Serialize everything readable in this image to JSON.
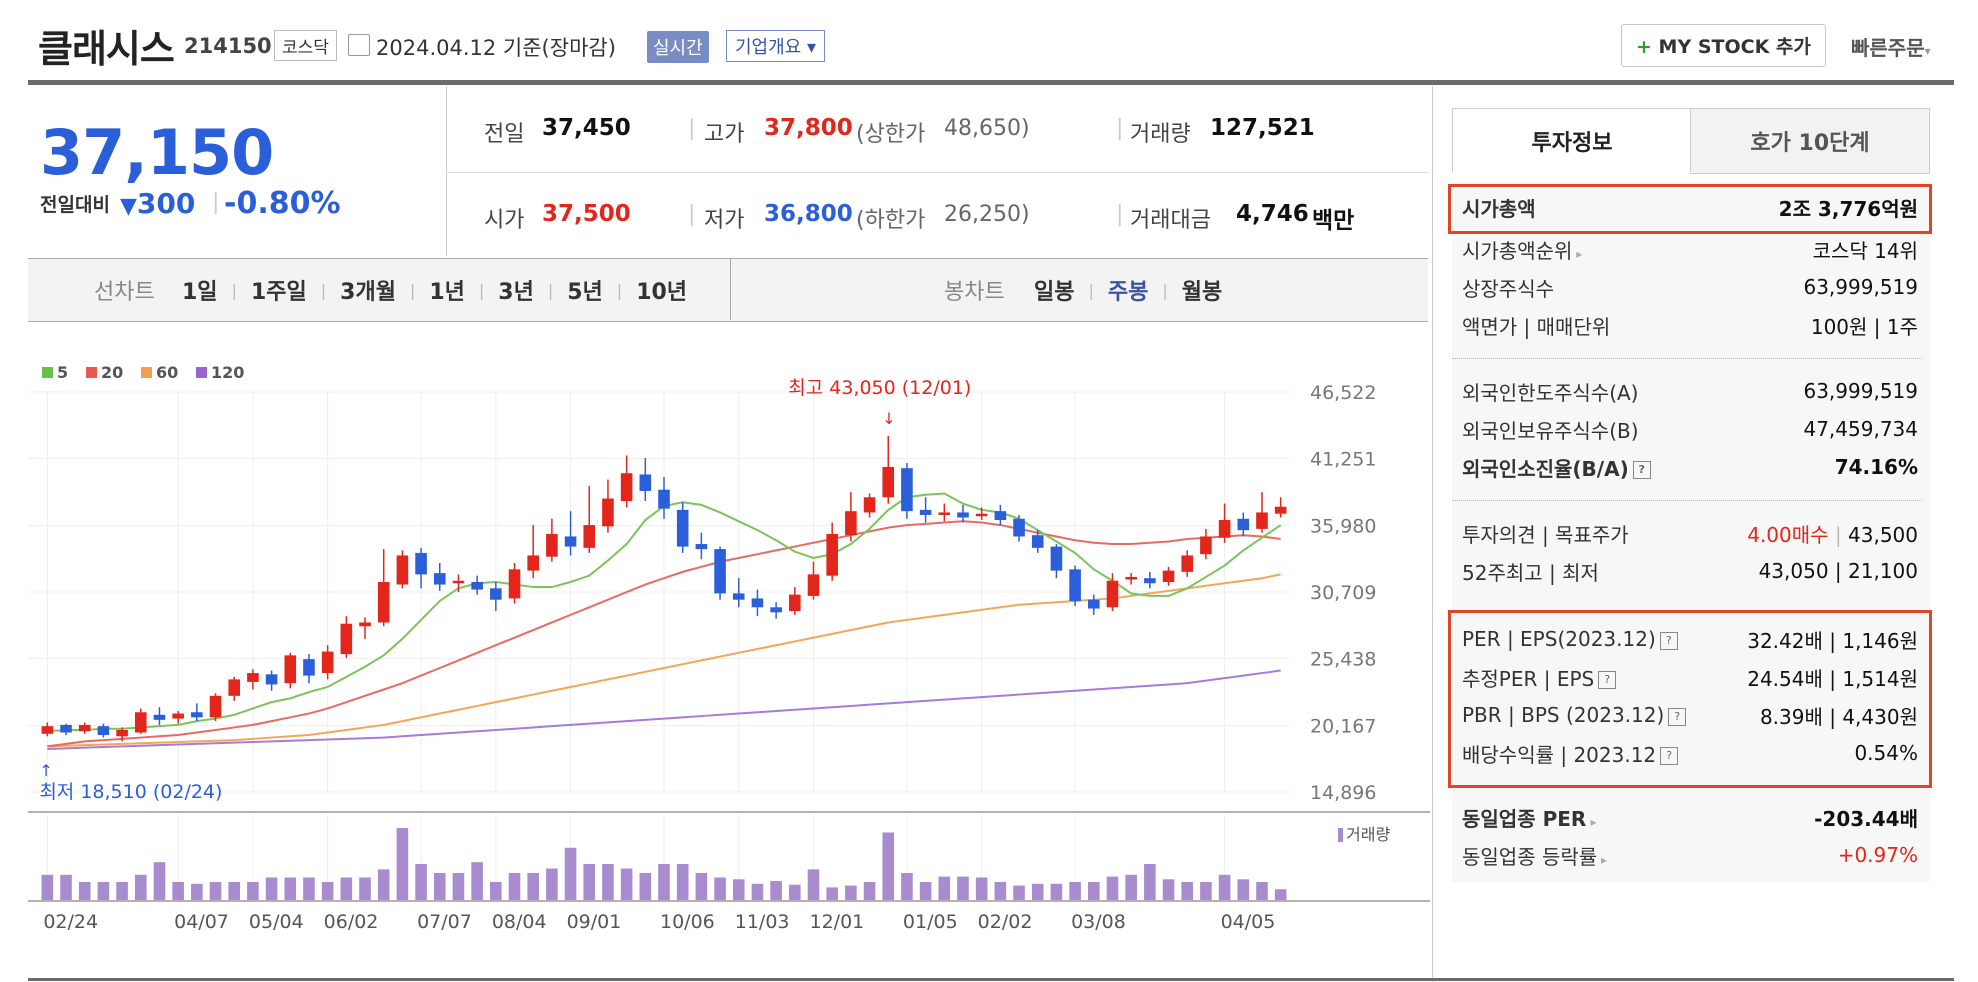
{
  "header": {
    "company_name": "클래시스",
    "code": "214150",
    "market": "코스닥",
    "date_label": "2024.04.12 기준(장마감)",
    "realtime_label": "실시간",
    "company_info_label": "기업개요",
    "my_stock_label": "MY STOCK 추가",
    "quick_order_label": "빠른주문"
  },
  "quote": {
    "price": "37,150",
    "change_label": "전일대비",
    "change_value": "300",
    "change_pct": "-0.80%",
    "prev_close_label": "전일",
    "prev_close": "37,450",
    "high_label": "고가",
    "high": "37,800",
    "upper_limit_label": "(상한가",
    "upper_limit": "48,650)",
    "volume_label": "거래량",
    "volume": "127,521",
    "open_label": "시가",
    "open": "37,500",
    "low_label": "저가",
    "low": "36,800",
    "lower_limit_label": "(하한가",
    "lower_limit": "26,250)",
    "amount_label": "거래대금",
    "amount": "4,746",
    "amount_unit": "백만"
  },
  "periods": {
    "line_label": "선차트",
    "line_items": [
      "1일",
      "1주일",
      "3개월",
      "1년",
      "3년",
      "5년",
      "10년"
    ],
    "candle_label": "봉차트",
    "candle_items": [
      "일봉",
      "주봉",
      "월봉"
    ],
    "active_candle": "주봉"
  },
  "chart_data": {
    "type": "candlestick",
    "legend": [
      {
        "name": "5",
        "color": "#6cc04a"
      },
      {
        "name": "20",
        "color": "#e85a4f"
      },
      {
        "name": "60",
        "color": "#f0a050"
      },
      {
        "name": "120",
        "color": "#9966cc"
      }
    ],
    "y_ticks": [
      "46,522",
      "41,251",
      "35,980",
      "30,709",
      "25,438",
      "20,167",
      "14,896"
    ],
    "ylim": [
      14896,
      46522
    ],
    "x_ticks": [
      "02/24",
      "04/07",
      "05/04",
      "06/02",
      "07/07",
      "08/04",
      "09/01",
      "10/06",
      "11/03",
      "12/01",
      "01/05",
      "02/02",
      "03/08",
      "04/05"
    ],
    "high_annotation": "최고 43,050 (12/01)",
    "low_annotation": "최저 18,510 (02/24)",
    "volume_label": "거래량",
    "candles": [
      [
        19500,
        20100,
        19300,
        20400
      ],
      [
        20200,
        19600,
        19400,
        20300
      ],
      [
        19700,
        20200,
        19500,
        20400
      ],
      [
        20100,
        19400,
        19200,
        20300
      ],
      [
        19300,
        19800,
        18900,
        20000
      ],
      [
        19600,
        21200,
        19500,
        21500
      ],
      [
        21000,
        20600,
        20200,
        21600
      ],
      [
        20700,
        21100,
        20300,
        21300
      ],
      [
        21200,
        20800,
        20500,
        21900
      ],
      [
        20800,
        22500,
        20500,
        22700
      ],
      [
        22500,
        23800,
        22100,
        24000
      ],
      [
        23600,
        24300,
        23000,
        24600
      ],
      [
        24200,
        23400,
        22900,
        24500
      ],
      [
        23500,
        25700,
        23100,
        25900
      ],
      [
        25400,
        24100,
        23500,
        25800
      ],
      [
        24300,
        26000,
        23800,
        26500
      ],
      [
        25800,
        28200,
        25500,
        28800
      ],
      [
        28000,
        28300,
        27000,
        28700
      ],
      [
        28300,
        31500,
        28000,
        34100
      ],
      [
        31300,
        33600,
        31000,
        34000
      ],
      [
        33800,
        32100,
        31000,
        34200
      ],
      [
        32200,
        31300,
        30800,
        33000
      ],
      [
        31400,
        31600,
        30700,
        32100
      ],
      [
        31500,
        30900,
        30500,
        32000
      ],
      [
        31000,
        30100,
        29200,
        31500
      ],
      [
        30200,
        32500,
        29800,
        33000
      ],
      [
        32400,
        33600,
        31800,
        36000
      ],
      [
        33500,
        35300,
        33100,
        36500
      ],
      [
        35100,
        34300,
        33600,
        37100
      ],
      [
        34200,
        36000,
        33800,
        39100
      ],
      [
        35900,
        38100,
        35400,
        39600
      ],
      [
        37900,
        40100,
        37400,
        41500
      ],
      [
        40000,
        38700,
        37900,
        41300
      ],
      [
        38800,
        37300,
        36500,
        39800
      ],
      [
        37200,
        34300,
        33800,
        37800
      ],
      [
        34500,
        34100,
        33300,
        35400
      ],
      [
        34100,
        30600,
        30100,
        34300
      ],
      [
        30600,
        30100,
        29500,
        31800
      ],
      [
        30200,
        29500,
        28800,
        30900
      ],
      [
        29500,
        29100,
        28600,
        29900
      ],
      [
        29200,
        30500,
        28900,
        31100
      ],
      [
        30400,
        32100,
        30100,
        33100
      ],
      [
        32000,
        35300,
        31600,
        36200
      ],
      [
        35200,
        37100,
        34700,
        38600
      ],
      [
        37000,
        38200,
        36600,
        38500
      ],
      [
        38200,
        40600,
        37700,
        43050
      ],
      [
        40500,
        37100,
        36500,
        40900
      ],
      [
        37200,
        36800,
        36200,
        38200
      ],
      [
        36800,
        37000,
        36300,
        37700
      ],
      [
        37000,
        36600,
        36200,
        37600
      ],
      [
        36700,
        36900,
        36400,
        37400
      ],
      [
        37100,
        36400,
        36000,
        37600
      ],
      [
        36500,
        35100,
        34700,
        36800
      ],
      [
        35200,
        34200,
        33800,
        35600
      ],
      [
        34300,
        32400,
        31800,
        34500
      ],
      [
        32500,
        30000,
        29600,
        32800
      ],
      [
        30100,
        29400,
        28900,
        30500
      ],
      [
        29500,
        31600,
        29200,
        32200
      ],
      [
        31700,
        31900,
        31300,
        32200
      ],
      [
        31800,
        31400,
        31000,
        32300
      ],
      [
        31500,
        32400,
        31200,
        32700
      ],
      [
        32300,
        33600,
        31900,
        34000
      ],
      [
        33700,
        35100,
        33300,
        35700
      ],
      [
        35000,
        36400,
        34600,
        37700
      ],
      [
        36500,
        35600,
        35100,
        37000
      ],
      [
        35700,
        37000,
        35400,
        38600
      ],
      [
        36900,
        37450,
        36600,
        38200
      ]
    ],
    "volumes": [
      28,
      28,
      20,
      20,
      20,
      28,
      42,
      20,
      18,
      20,
      20,
      20,
      25,
      25,
      25,
      20,
      25,
      25,
      34,
      80,
      40,
      30,
      30,
      42,
      20,
      30,
      30,
      35,
      58,
      40,
      40,
      35,
      30,
      40,
      40,
      30,
      25,
      23,
      18,
      21,
      17,
      34,
      14,
      16,
      20,
      75,
      30,
      20,
      26,
      26,
      25,
      20,
      16,
      18,
      18,
      20,
      20,
      26,
      28,
      40,
      23,
      20,
      20,
      28,
      23,
      20,
      12
    ],
    "ma5": [
      19700,
      19800,
      19800,
      19900,
      19900,
      20000,
      20100,
      20200,
      20500,
      20700,
      21000,
      21500,
      22000,
      22300,
      22800,
      23200,
      24000,
      24800,
      25700,
      27000,
      28500,
      30000,
      31000,
      31400,
      31500,
      31300,
      31100,
      31100,
      31500,
      32000,
      33200,
      34500,
      36400,
      37500,
      37800,
      37600,
      37000,
      36300,
      35600,
      34800,
      33900,
      33400,
      33700,
      34500,
      35700,
      37200,
      38200,
      38400,
      38500,
      37700,
      37200,
      37000,
      36500,
      35600,
      34700,
      33800,
      32500,
      31600,
      30600,
      30400,
      30400,
      31000,
      31900,
      32800,
      34000,
      35000,
      36000
    ],
    "ma20": [
      18500,
      18700,
      18900,
      19000,
      19100,
      19200,
      19300,
      19400,
      19600,
      19800,
      20000,
      20200,
      20500,
      20800,
      21100,
      21500,
      22000,
      22500,
      23000,
      23500,
      24100,
      24700,
      25300,
      25900,
      26500,
      27100,
      27700,
      28300,
      28900,
      29500,
      30100,
      30700,
      31300,
      31800,
      32300,
      32700,
      33100,
      33400,
      33700,
      34000,
      34300,
      34600,
      34900,
      35200,
      35500,
      35800,
      36000,
      36100,
      36200,
      36300,
      36200,
      36000,
      35700,
      35400,
      35100,
      34800,
      34600,
      34500,
      34500,
      34600,
      34700,
      34900,
      35000,
      35100,
      35200,
      35100,
      34900
    ],
    "ma60": [
      18500,
      18550,
      18600,
      18650,
      18700,
      18750,
      18800,
      18850,
      18900,
      18950,
      19000,
      19100,
      19200,
      19300,
      19400,
      19600,
      19800,
      20000,
      20200,
      20500,
      20800,
      21100,
      21400,
      21700,
      22000,
      22300,
      22600,
      22900,
      23200,
      23500,
      23800,
      24100,
      24400,
      24700,
      25000,
      25300,
      25600,
      25900,
      26200,
      26500,
      26800,
      27100,
      27400,
      27700,
      28000,
      28300,
      28500,
      28700,
      28900,
      29100,
      29300,
      29500,
      29700,
      29800,
      29900,
      30000,
      30100,
      30200,
      30400,
      30600,
      30800,
      31000,
      31200,
      31400,
      31600,
      31800,
      32100
    ],
    "ma120": [
      18300,
      18350,
      18400,
      18450,
      18500,
      18550,
      18600,
      18650,
      18700,
      18750,
      18800,
      18850,
      18900,
      18950,
      19000,
      19050,
      19100,
      19150,
      19200,
      19300,
      19400,
      19500,
      19600,
      19700,
      19800,
      19900,
      20000,
      20100,
      20200,
      20300,
      20400,
      20500,
      20600,
      20700,
      20800,
      20900,
      21000,
      21100,
      21200,
      21300,
      21400,
      21500,
      21600,
      21700,
      21800,
      21900,
      22000,
      22100,
      22200,
      22300,
      22400,
      22500,
      22600,
      22700,
      22800,
      22900,
      23000,
      23100,
      23200,
      23300,
      23400,
      23500,
      23700,
      23900,
      24100,
      24300,
      24500
    ]
  },
  "side": {
    "tab_invest": "투자정보",
    "tab_orderbook": "호가 10단계",
    "market_cap_label": "시가총액",
    "market_cap_value": "2조 3,776억원",
    "rows1": [
      {
        "label": "시가총액순위",
        "value": "코스닥 14위"
      },
      {
        "label": "상장주식수",
        "value": "63,999,519"
      },
      {
        "label": "액면가 | 매매단위",
        "value": "100원 | 1주"
      }
    ],
    "rows2": [
      {
        "label": "외국인한도주식수(A)",
        "value": "63,999,519"
      },
      {
        "label": "외국인보유주식수(B)",
        "value": "47,459,734"
      },
      {
        "label": "외국인소진율(B/A)",
        "value": "74.16%"
      }
    ],
    "opinion_label": "투자의견 | 목표주가",
    "opinion_value": "4.00매수",
    "target_price": "43,500",
    "w52_label": "52주최고 | 최저",
    "w52_value": "43,050 | 21,100",
    "rows3": [
      {
        "label": "PER | EPS(2023.12)",
        "value": "32.42배 | 1,146원"
      },
      {
        "label": "추정PER | EPS",
        "value": "24.54배 | 1,514원"
      },
      {
        "label": "PBR | BPS (2023.12)",
        "value": "8.39배 | 4,430원"
      },
      {
        "label": "배당수익률 | 2023.12",
        "value": "0.54%"
      }
    ],
    "industry_per_label": "동일업종 PER",
    "industry_per_value": "-203.44배",
    "industry_change_label": "동일업종 등락률",
    "industry_change_value": "+0.97%"
  }
}
